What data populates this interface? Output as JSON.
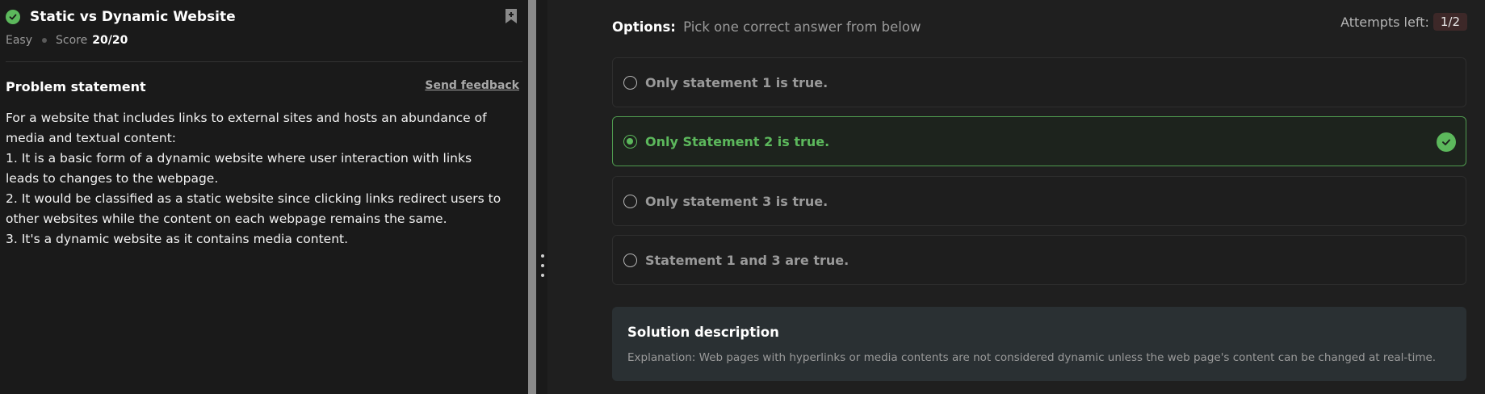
{
  "problem": {
    "title": "Static vs Dynamic Website",
    "difficulty": "Easy",
    "score_label": "Score",
    "score_value": "20/20",
    "statement_title": "Problem statement",
    "send_feedback": "Send feedback",
    "statement_lines": [
      "For a website that includes links to external sites and hosts an abundance of",
      "media and textual content:",
      "1. It is a basic form of a dynamic website where user interaction with links",
      "leads to changes to the webpage.",
      "2. It would be classified as a static website since clicking links redirect users to",
      "other websites while the content on each webpage remains the same.",
      "3. It's a dynamic website as it contains media content."
    ]
  },
  "quiz": {
    "options_label": "Options:",
    "options_hint": "Pick one correct answer from below",
    "attempts_label": "Attempts left:",
    "attempts_value": "1/2",
    "options": [
      {
        "text": "Only statement 1 is true.",
        "selected": false
      },
      {
        "text": "Only Statement 2 is true.",
        "selected": true
      },
      {
        "text": "Only statement 3 is true.",
        "selected": false
      },
      {
        "text": "Statement 1 and 3 are true.",
        "selected": false
      }
    ]
  },
  "solution": {
    "title": "Solution description",
    "text": "Explanation: Web pages with hyperlinks or media contents are not considered dynamic unless the web page's content can be changed at real-time."
  },
  "colors": {
    "accent_green": "#5cb85c",
    "background": "#1a1a1a",
    "panel": "#1f1f1f",
    "solution_bg": "#2a3033"
  },
  "icons": {
    "solved": "check-circle-icon",
    "bookmark": "bookmark-add-icon",
    "correct": "check-circle-icon"
  }
}
